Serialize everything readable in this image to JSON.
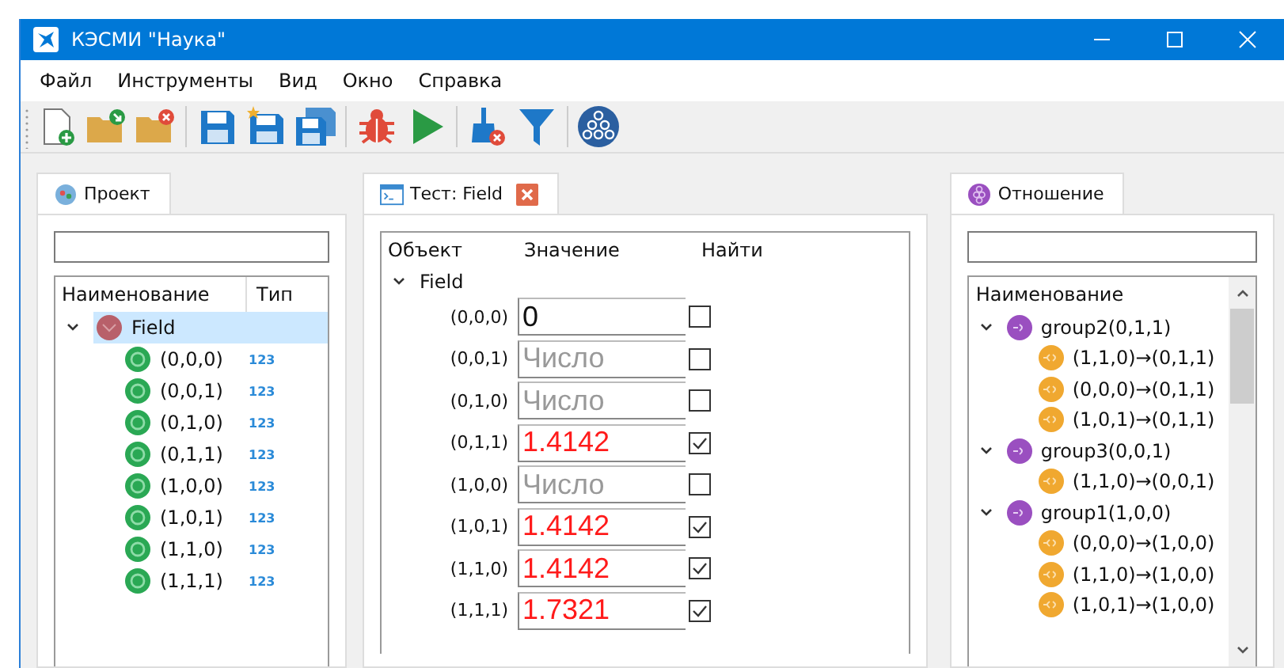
{
  "window": {
    "title": "КЭСМИ \"Наука\""
  },
  "menu": [
    "Файл",
    "Инструменты",
    "Вид",
    "Окно",
    "Справка"
  ],
  "toolbar": [
    {
      "kind": "new"
    },
    {
      "kind": "open"
    },
    {
      "kind": "close"
    },
    {
      "kind": "sep"
    },
    {
      "kind": "save"
    },
    {
      "kind": "saveas"
    },
    {
      "kind": "saveall"
    },
    {
      "kind": "sep"
    },
    {
      "kind": "debug"
    },
    {
      "kind": "run"
    },
    {
      "kind": "sep"
    },
    {
      "kind": "clean"
    },
    {
      "kind": "filter"
    },
    {
      "kind": "sep"
    },
    {
      "kind": "graph"
    }
  ],
  "project": {
    "tab": "Проект",
    "columns": [
      "Наименование",
      "Тип"
    ],
    "root": {
      "label": "Field",
      "expanded": true,
      "selected": true,
      "children": [
        {
          "label": "(0,0,0)",
          "type": "123",
          "selected": false
        },
        {
          "label": "(0,0,1)",
          "type": "123",
          "selected": false
        },
        {
          "label": "(0,1,0)",
          "type": "123",
          "selected": false
        },
        {
          "label": "(0,1,1)",
          "type": "123",
          "selected": false
        },
        {
          "label": "(1,0,0)",
          "type": "123",
          "selected": false
        },
        {
          "label": "(1,0,1)",
          "type": "123",
          "selected": false
        },
        {
          "label": "(1,1,0)",
          "type": "123",
          "selected": false
        },
        {
          "label": "(1,1,1)",
          "type": "123",
          "selected": false
        }
      ]
    }
  },
  "test": {
    "tab": "Тест: Field",
    "columns": [
      "Объект",
      "Значение",
      "Найти"
    ],
    "group": {
      "label": "Field",
      "expanded": true
    },
    "rows": [
      {
        "label": "(0,0,0)",
        "value": "0",
        "highlighted": false,
        "checked": false
      },
      {
        "label": "(0,0,1)",
        "placeholder": "Число",
        "highlighted": false,
        "checked": false
      },
      {
        "label": "(0,1,0)",
        "placeholder": "Число",
        "highlighted": false,
        "checked": false
      },
      {
        "label": "(0,1,1)",
        "value": "1.4142",
        "highlighted": true,
        "checked": true
      },
      {
        "label": "(1,0,0)",
        "placeholder": "Число",
        "highlighted": false,
        "checked": false
      },
      {
        "label": "(1,0,1)",
        "value": "1.4142",
        "highlighted": true,
        "checked": true
      },
      {
        "label": "(1,1,0)",
        "value": "1.4142",
        "highlighted": true,
        "checked": true
      },
      {
        "label": "(1,1,1)",
        "value": "1.7321",
        "highlighted": true,
        "checked": true
      }
    ]
  },
  "relation": {
    "tab": "Отношение",
    "columns": [
      "Наименование"
    ],
    "groups": [
      {
        "label": "group2(0,1,1)",
        "expanded": true,
        "children": [
          "(1,1,0)→(0,1,1)",
          "(0,0,0)→(0,1,1)",
          "(1,0,1)→(0,1,1)"
        ]
      },
      {
        "label": "group3(0,0,1)",
        "expanded": true,
        "children": [
          "(1,1,0)→(0,0,1)"
        ]
      },
      {
        "label": "group1(1,0,0)",
        "expanded": true,
        "children": [
          "(0,0,0)→(1,0,0)",
          "(1,1,0)→(1,0,0)",
          "(1,0,1)→(1,0,0)"
        ]
      }
    ]
  }
}
